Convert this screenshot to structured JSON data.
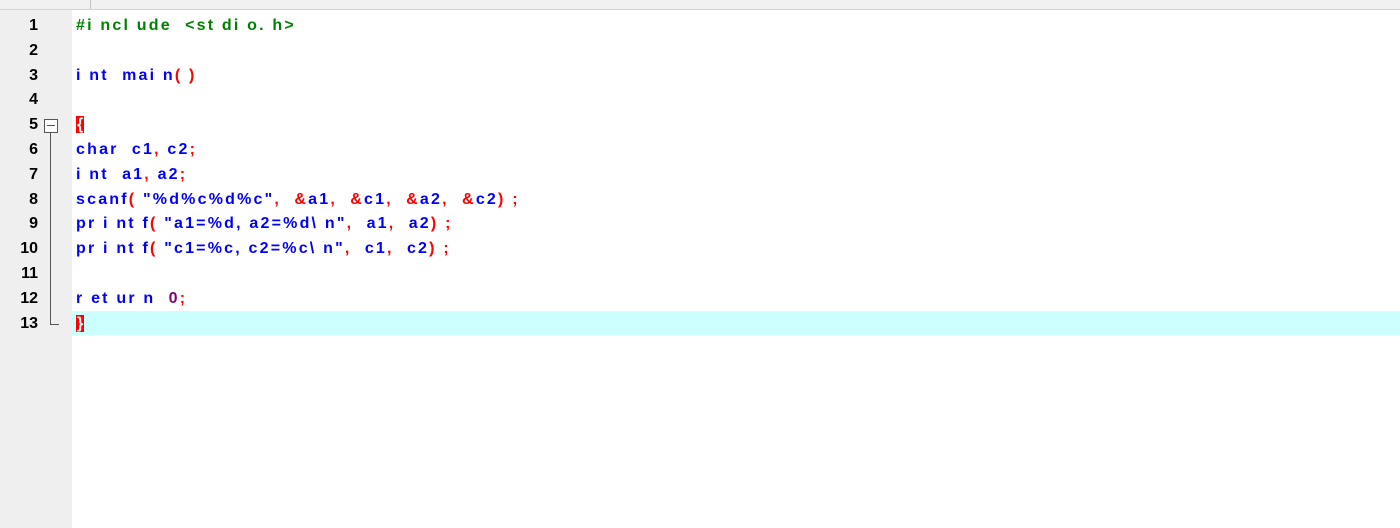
{
  "editor": {
    "lines": [
      {
        "num": "1",
        "tokens": [
          {
            "t": "#i ncl ude  <st di o. h>",
            "c": "pp"
          }
        ]
      },
      {
        "num": "2",
        "tokens": []
      },
      {
        "num": "3",
        "tokens": [
          {
            "t": "i nt  mai n",
            "c": "kw"
          },
          {
            "t": "( )",
            "c": "op"
          }
        ]
      },
      {
        "num": "4",
        "tokens": []
      },
      {
        "num": "5",
        "tokens": [
          {
            "t": "{",
            "c": "brace"
          }
        ]
      },
      {
        "num": "6",
        "tokens": [
          {
            "t": "char  c1",
            "c": "kw"
          },
          {
            "t": ", ",
            "c": "op"
          },
          {
            "t": "c2",
            "c": "kw"
          },
          {
            "t": ";",
            "c": "op"
          }
        ]
      },
      {
        "num": "7",
        "tokens": [
          {
            "t": "i nt  a1",
            "c": "kw"
          },
          {
            "t": ", ",
            "c": "op"
          },
          {
            "t": "a2",
            "c": "kw"
          },
          {
            "t": ";",
            "c": "op"
          }
        ]
      },
      {
        "num": "8",
        "tokens": [
          {
            "t": "scanf",
            "c": "kw"
          },
          {
            "t": "( ",
            "c": "op"
          },
          {
            "t": "\"%d%c%d%c\"",
            "c": "kw"
          },
          {
            "t": ",  &",
            "c": "op"
          },
          {
            "t": "a1",
            "c": "kw"
          },
          {
            "t": ",  &",
            "c": "op"
          },
          {
            "t": "c1",
            "c": "kw"
          },
          {
            "t": ",  &",
            "c": "op"
          },
          {
            "t": "a2",
            "c": "kw"
          },
          {
            "t": ",  &",
            "c": "op"
          },
          {
            "t": "c2",
            "c": "kw"
          },
          {
            "t": ") ;",
            "c": "op"
          }
        ]
      },
      {
        "num": "9",
        "tokens": [
          {
            "t": "pr i nt f",
            "c": "kw"
          },
          {
            "t": "( ",
            "c": "op"
          },
          {
            "t": "\"a1=%d, a2=%d\\ n\"",
            "c": "kw"
          },
          {
            "t": ",  ",
            "c": "op"
          },
          {
            "t": "a1",
            "c": "kw"
          },
          {
            "t": ",  ",
            "c": "op"
          },
          {
            "t": "a2",
            "c": "kw"
          },
          {
            "t": ") ;",
            "c": "op"
          }
        ]
      },
      {
        "num": "10",
        "tokens": [
          {
            "t": "pr i nt f",
            "c": "kw"
          },
          {
            "t": "( ",
            "c": "op"
          },
          {
            "t": "\"c1=%c, c2=%c\\ n\"",
            "c": "kw"
          },
          {
            "t": ",  ",
            "c": "op"
          },
          {
            "t": "c1",
            "c": "kw"
          },
          {
            "t": ",  ",
            "c": "op"
          },
          {
            "t": "c2",
            "c": "kw"
          },
          {
            "t": ") ;",
            "c": "op"
          }
        ]
      },
      {
        "num": "11",
        "tokens": []
      },
      {
        "num": "12",
        "tokens": [
          {
            "t": "r et ur n  ",
            "c": "kw"
          },
          {
            "t": "0",
            "c": "purple"
          },
          {
            "t": ";",
            "c": "op"
          }
        ]
      },
      {
        "num": "13",
        "tokens": [
          {
            "t": "}",
            "c": "brace"
          }
        ]
      }
    ],
    "highlighted_line": "13",
    "colors": {
      "preprocessor": "#008000",
      "keyword": "#0000ff",
      "operator": "#ff0000",
      "number": "#800080",
      "current_line": "#ccffff",
      "gutter": "#efefef"
    }
  }
}
